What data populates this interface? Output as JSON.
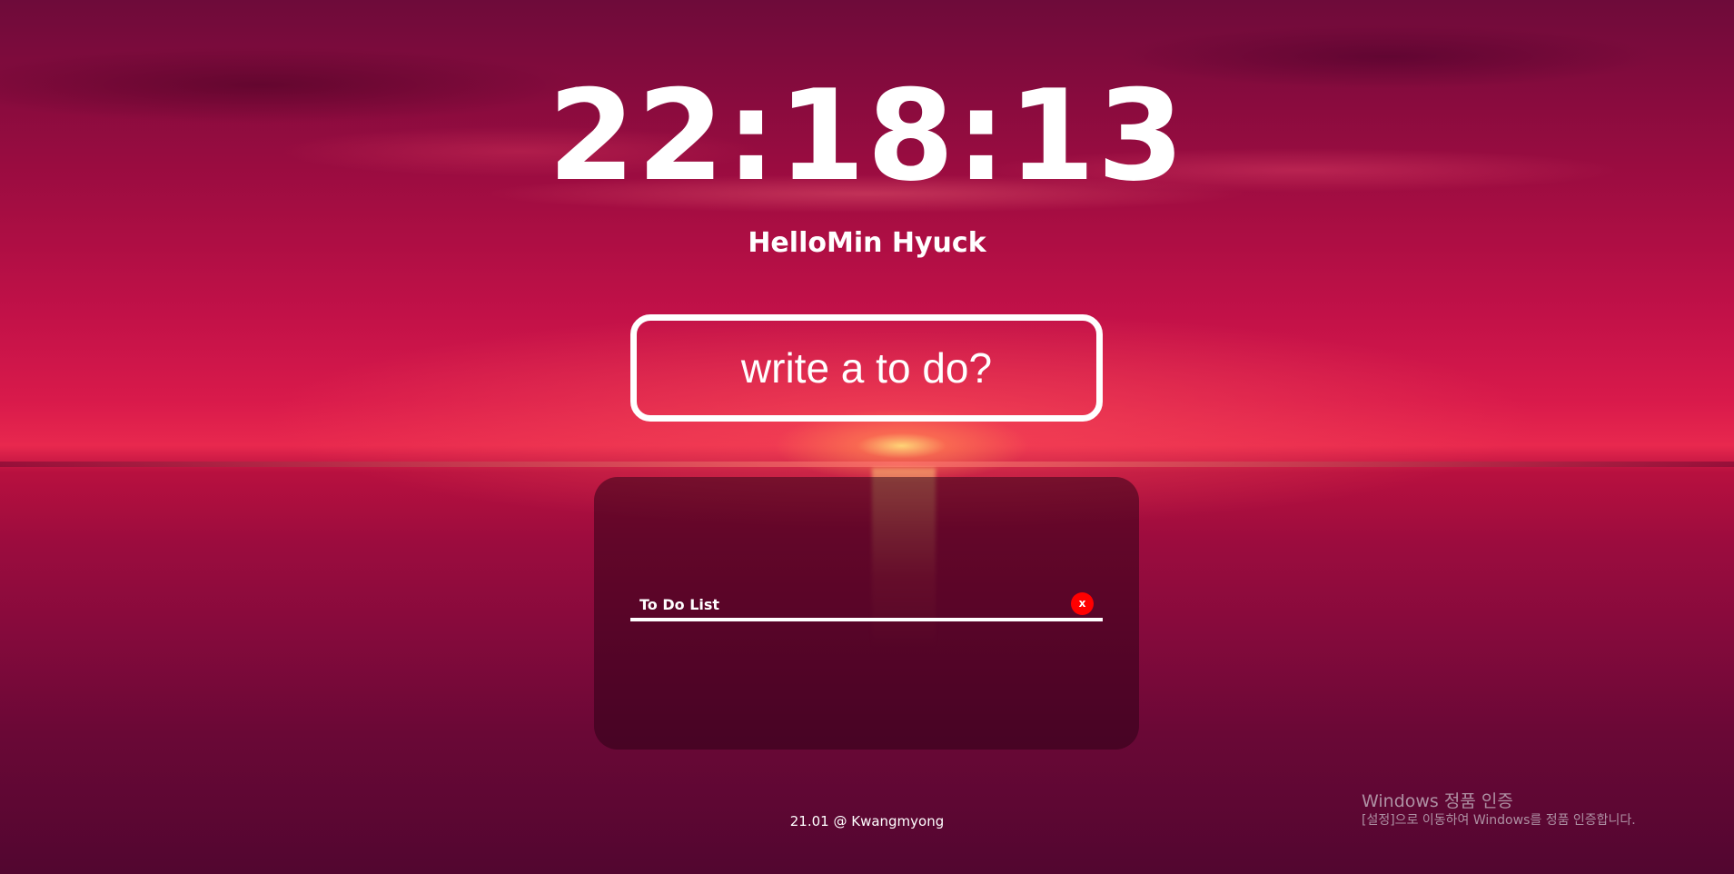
{
  "clock": {
    "time": "22:18:13"
  },
  "greeting": {
    "text": "HelloMin Hyuck"
  },
  "todo_form": {
    "placeholder": "write a to do?"
  },
  "todo_list": {
    "items": [
      {
        "text": "To Do List",
        "delete_label": "x"
      }
    ]
  },
  "footer": {
    "text": "21.01 @ Kwangmyong"
  },
  "windows_activation": {
    "title": "Windows 정품 인증",
    "subtitle": "[설정]으로 이동하여 Windows를 정품 인증합니다."
  },
  "colors": {
    "delete_button": "#ff0000",
    "text": "#ffffff",
    "panel_background": "rgba(40, 0, 20, 0.5)"
  },
  "background": {
    "icon": "sunset-over-sea-image"
  }
}
